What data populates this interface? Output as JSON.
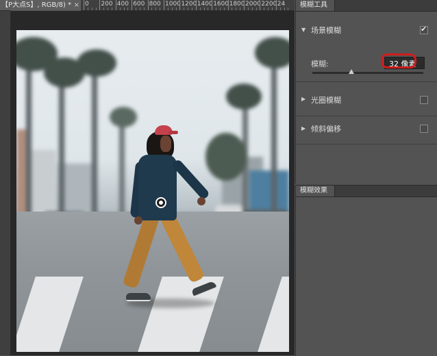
{
  "document": {
    "tab_title": "【P大点S】, RGB/8) *",
    "close_glyph": "×",
    "ruler_labels": [
      "0",
      "200",
      "400",
      "600",
      "800",
      "1000",
      "1200",
      "1400",
      "1600",
      "1800",
      "2000",
      "2200",
      "24"
    ]
  },
  "blur_tools_panel": {
    "tab_label": "模糊工具",
    "sections": [
      {
        "label": "场景模糊",
        "expanded": true,
        "checked": true
      },
      {
        "label": "光圈模糊",
        "expanded": false,
        "checked": false
      },
      {
        "label": "倾斜偏移",
        "expanded": false,
        "checked": false
      }
    ],
    "blur_label": "模糊:",
    "blur_value": "32 像素",
    "slider_fraction": 0.35,
    "highlight_color": "#d01c1c"
  },
  "blur_effects_panel": {
    "tab_label": "模糊效果"
  },
  "icons": {
    "expand": "triangle-down-icon",
    "collapse": "triangle-right-icon",
    "pin": "blur-pin-icon"
  }
}
